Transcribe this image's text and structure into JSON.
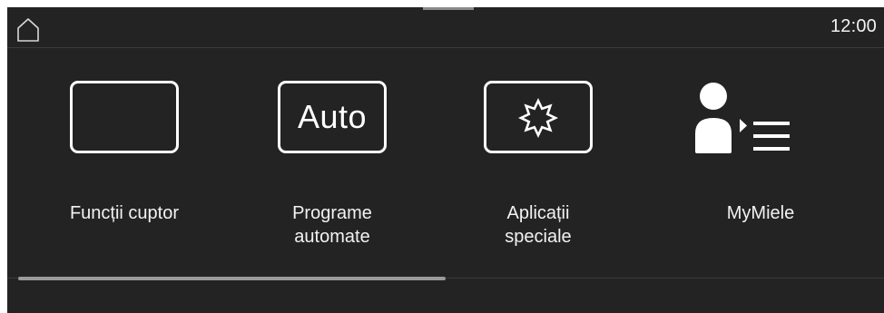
{
  "status_bar": {
    "home_icon": "home-icon",
    "time": "12:00"
  },
  "menu": {
    "tiles": [
      {
        "id": "oven-functions",
        "icon": "blank-frame-icon",
        "label": "Funcții cuptor"
      },
      {
        "id": "automatic-programs",
        "icon": "auto-icon",
        "icon_text": "Auto",
        "label": "Programe\nautomate"
      },
      {
        "id": "special-applications",
        "icon": "star-burst-icon",
        "label": "Aplicații\nspeciale"
      },
      {
        "id": "mymiele",
        "icon": "user-list-icon",
        "label": "MyMiele"
      }
    ]
  },
  "scroll": {
    "visible_fraction": 0.5,
    "position": 0
  },
  "colors": {
    "background": "#232323",
    "foreground": "#ffffff",
    "scrollbar_thumb": "#9a9a9a"
  }
}
